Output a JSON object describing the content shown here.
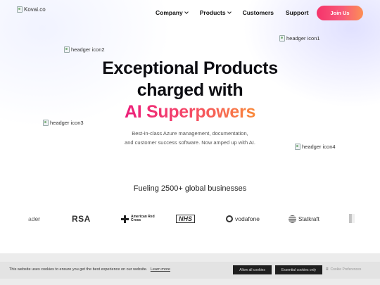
{
  "header": {
    "logo_alt": "Kovai.co",
    "nav": [
      {
        "label": "Company",
        "has_dropdown": true
      },
      {
        "label": "Products",
        "has_dropdown": true
      },
      {
        "label": "Customers",
        "has_dropdown": false
      },
      {
        "label": "Support",
        "has_dropdown": false
      }
    ],
    "cta_label": "Join Us"
  },
  "floating_icons": {
    "icon1": "headger icon1",
    "icon2": "headger icon2",
    "icon3": "headger icon3",
    "icon4": "headger icon4"
  },
  "hero": {
    "line1": "Exceptional Products",
    "line2": "charged with",
    "accent": "AI Superpowers",
    "sub_line1": "Best-in-class Azure management, documentation,",
    "sub_line2": "and customer success software. Now amped up with AI."
  },
  "clients": {
    "heading": "Fueling 2500+ global businesses",
    "logos": {
      "partial": "ader",
      "rsa": "RSA",
      "redcross": "American Red Cross",
      "nhs": "NHS",
      "vodafone": "vodafone",
      "statkraft": "Statkraft"
    }
  },
  "cookie_banner": {
    "text": "This website uses cookies to ensure you get the best experience on our website.",
    "learn_more": "Learn more",
    "allow_all": "Allow all cookies",
    "essential_only": "Essential cookies only",
    "preferences": "Cookie Preferences"
  },
  "colors": {
    "accent_gradient_start": "#ec1f7a",
    "accent_gradient_end": "#f98a3b",
    "cta_start": "#f5336b",
    "cta_end": "#fc8f55",
    "text_dark": "#0d0d12"
  }
}
